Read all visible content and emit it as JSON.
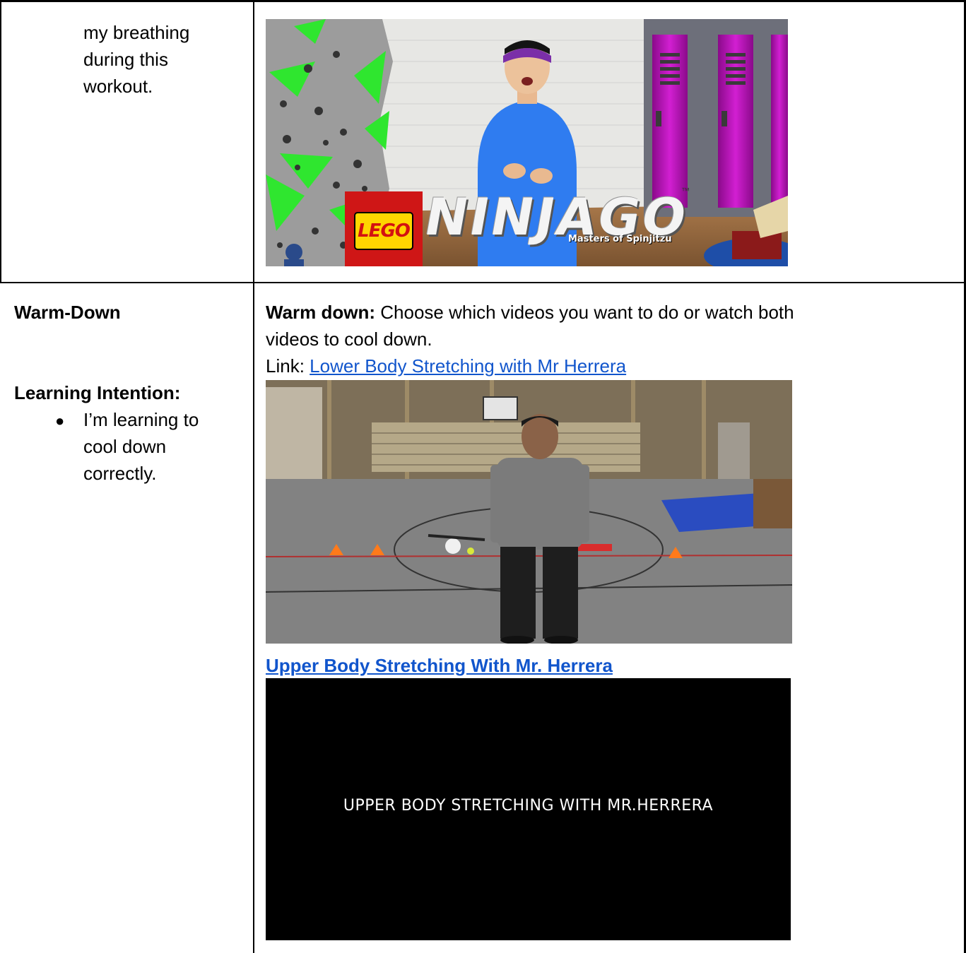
{
  "row1": {
    "left_lines": [
      "my breathing",
      "during this",
      "workout."
    ],
    "thumbnail": {
      "logo": "LEGO",
      "title": "NINJAGO",
      "tagline": "Masters of Spinjitzu",
      "trademark": "™"
    }
  },
  "row2": {
    "heading": "Warm-Down",
    "learning_label": "Learning Intention:",
    "bullet_lines": [
      "I’m learning to",
      "cool down",
      "correctly."
    ],
    "bullet_icon": "bullet-dot",
    "instruction_bold": "Warm down:",
    "instruction_line1": " Choose which videos you want to do or watch both",
    "instruction_line2": "videos to cool down.",
    "link_prefix": "Link: ",
    "link1_text": "Lower Body Stretching with Mr Herrera",
    "link2_text": "Upper Body Stretching With Mr. Herrera",
    "video2_caption": "UPPER BODY STRETCHING WITH MR.HERRERA"
  },
  "colors": {
    "link": "#1155cc",
    "ninjago_green": "#39ff14",
    "locker_magenta": "#c20bc2",
    "shirt_blue": "#2f7cf0"
  }
}
